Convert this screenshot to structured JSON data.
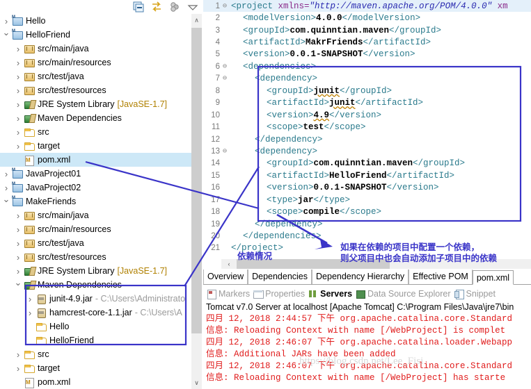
{
  "explorer": {
    "toolbar": [
      {
        "name": "collapse-all-icon",
        "label": "Collapse All"
      },
      {
        "name": "link-with-editor-icon",
        "label": "Link with Editor"
      },
      {
        "name": "view-menu-icon",
        "label": "View Menu"
      },
      {
        "name": "chevron-down-icon",
        "label": "Minimize"
      }
    ],
    "scroll_up": "∧",
    "scroll_down": "∨",
    "tree": [
      {
        "indent": 0,
        "arrow": "closed",
        "icon": "ic-proj",
        "label": "Hello",
        "suffix": "",
        "selected": false
      },
      {
        "indent": 0,
        "arrow": "open",
        "icon": "ic-proj",
        "label": "HelloFriend",
        "suffix": "",
        "selected": false
      },
      {
        "indent": 1,
        "arrow": "closed",
        "icon": "ic-pkg",
        "label": "src/main/java",
        "suffix": "",
        "selected": false
      },
      {
        "indent": 1,
        "arrow": "closed",
        "icon": "ic-pkg",
        "label": "src/main/resources",
        "suffix": "",
        "selected": false
      },
      {
        "indent": 1,
        "arrow": "closed",
        "icon": "ic-pkg",
        "label": "src/test/java",
        "suffix": "",
        "selected": false
      },
      {
        "indent": 1,
        "arrow": "closed",
        "icon": "ic-pkg",
        "label": "src/test/resources",
        "suffix": "",
        "selected": false
      },
      {
        "indent": 1,
        "arrow": "closed",
        "icon": "ic-lib",
        "label": "JRE System Library",
        "suffix": "[JavaSE-1.7]",
        "selected": false
      },
      {
        "indent": 1,
        "arrow": "closed",
        "icon": "ic-lib",
        "label": "Maven Dependencies",
        "suffix": "",
        "selected": false
      },
      {
        "indent": 1,
        "arrow": "closed",
        "icon": "ic-fold",
        "label": "src",
        "suffix": "",
        "selected": false
      },
      {
        "indent": 1,
        "arrow": "closed",
        "icon": "ic-fold",
        "label": "target",
        "suffix": "",
        "selected": false
      },
      {
        "indent": 1,
        "arrow": "none",
        "icon": "ic-xml",
        "label": "pom.xml",
        "suffix": "",
        "selected": true
      },
      {
        "indent": 0,
        "arrow": "closed",
        "icon": "ic-proj",
        "label": "JavaProject01",
        "suffix": "",
        "selected": false
      },
      {
        "indent": 0,
        "arrow": "closed",
        "icon": "ic-proj",
        "label": "JavaProject02",
        "suffix": "",
        "selected": false
      },
      {
        "indent": 0,
        "arrow": "open",
        "icon": "ic-proj",
        "label": "MakeFriends",
        "suffix": "",
        "selected": false
      },
      {
        "indent": 1,
        "arrow": "closed",
        "icon": "ic-pkg",
        "label": "src/main/java",
        "suffix": "",
        "selected": false
      },
      {
        "indent": 1,
        "arrow": "closed",
        "icon": "ic-pkg",
        "label": "src/main/resources",
        "suffix": "",
        "selected": false
      },
      {
        "indent": 1,
        "arrow": "closed",
        "icon": "ic-pkg",
        "label": "src/test/java",
        "suffix": "",
        "selected": false
      },
      {
        "indent": 1,
        "arrow": "closed",
        "icon": "ic-pkg",
        "label": "src/test/resources",
        "suffix": "",
        "selected": false
      },
      {
        "indent": 1,
        "arrow": "closed",
        "icon": "ic-lib",
        "label": "JRE System Library",
        "suffix": "[JavaSE-1.7]",
        "selected": false
      },
      {
        "indent": 1,
        "arrow": "open",
        "icon": "ic-lib",
        "label": "Maven Dependencies",
        "suffix": "",
        "selected": false
      },
      {
        "indent": 2,
        "arrow": "closed",
        "icon": "ic-jar",
        "label": "junit-4.9.jar",
        "suffix": "- C:\\Users\\Administrato",
        "selected": false
      },
      {
        "indent": 2,
        "arrow": "closed",
        "icon": "ic-jar",
        "label": "hamcrest-core-1.1.jar",
        "suffix": "- C:\\Users\\A",
        "selected": false
      },
      {
        "indent": 2,
        "arrow": "none",
        "icon": "ic-fold",
        "label": "Hello",
        "suffix": "",
        "selected": false
      },
      {
        "indent": 2,
        "arrow": "none",
        "icon": "ic-fold",
        "label": "HelloFriend",
        "suffix": "",
        "selected": false
      },
      {
        "indent": 1,
        "arrow": "closed",
        "icon": "ic-fold",
        "label": "src",
        "suffix": "",
        "selected": false
      },
      {
        "indent": 1,
        "arrow": "closed",
        "icon": "ic-fold",
        "label": "target",
        "suffix": "",
        "selected": false
      },
      {
        "indent": 1,
        "arrow": "none",
        "icon": "ic-xml",
        "label": "pom.xml",
        "suffix": "",
        "selected": false
      }
    ]
  },
  "editor": {
    "lines": [
      {
        "n": "1",
        "fold": "⊖",
        "indent": 0,
        "first": true,
        "parts": [
          {
            "t": "tag",
            "v": "<project "
          },
          {
            "t": "attr",
            "v": "xmlns="
          },
          {
            "t": "aval",
            "v": "\"http://maven.apache.org/POM/4.0.0\""
          },
          {
            "t": "attr",
            "v": " xm"
          }
        ]
      },
      {
        "n": "2",
        "fold": "",
        "indent": 1,
        "parts": [
          {
            "t": "tag",
            "v": "<modelVersion>"
          },
          {
            "t": "tagv",
            "v": "4.0.0"
          },
          {
            "t": "tag",
            "v": "</modelVersion>"
          }
        ]
      },
      {
        "n": "3",
        "fold": "",
        "indent": 1,
        "parts": [
          {
            "t": "tag",
            "v": "<groupId>"
          },
          {
            "t": "tagv",
            "v": "com.quinntian.maven"
          },
          {
            "t": "tag",
            "v": "</groupId>"
          }
        ]
      },
      {
        "n": "4",
        "fold": "",
        "indent": 1,
        "parts": [
          {
            "t": "tag",
            "v": "<artifactId>"
          },
          {
            "t": "tagv",
            "v": "MakrFriends"
          },
          {
            "t": "tag",
            "v": "</artifactId>"
          }
        ]
      },
      {
        "n": "5",
        "fold": "",
        "indent": 1,
        "parts": [
          {
            "t": "tag",
            "v": "<version>"
          },
          {
            "t": "tagv",
            "v": "0.0.1-SNAPSHOT"
          },
          {
            "t": "tag",
            "v": "</version>"
          }
        ]
      },
      {
        "n": "6",
        "fold": "⊖",
        "indent": 1,
        "parts": [
          {
            "t": "tag",
            "v": "<dependencies>"
          }
        ]
      },
      {
        "n": "7",
        "fold": "⊖",
        "indent": 2,
        "parts": [
          {
            "t": "tag",
            "v": "<dependency>"
          }
        ]
      },
      {
        "n": "8",
        "fold": "",
        "indent": 3,
        "parts": [
          {
            "t": "tag",
            "v": "<groupId>"
          },
          {
            "t": "tagv sq",
            "v": "junit"
          },
          {
            "t": "tag",
            "v": "</groupId>"
          }
        ]
      },
      {
        "n": "9",
        "fold": "",
        "indent": 3,
        "parts": [
          {
            "t": "tag",
            "v": "<artifactId>"
          },
          {
            "t": "tagv sq",
            "v": "junit"
          },
          {
            "t": "tag",
            "v": "</artifactId>"
          }
        ]
      },
      {
        "n": "10",
        "fold": "",
        "indent": 3,
        "parts": [
          {
            "t": "tag",
            "v": "<version>"
          },
          {
            "t": "tagv sq",
            "v": "4.9"
          },
          {
            "t": "tag",
            "v": "</version>"
          }
        ]
      },
      {
        "n": "11",
        "fold": "",
        "indent": 3,
        "parts": [
          {
            "t": "tag",
            "v": "<scope>"
          },
          {
            "t": "tagv",
            "v": "test"
          },
          {
            "t": "tag",
            "v": "</scope>"
          }
        ]
      },
      {
        "n": "12",
        "fold": "",
        "indent": 2,
        "parts": [
          {
            "t": "tag",
            "v": "</dependency>"
          }
        ]
      },
      {
        "n": "13",
        "fold": "⊖",
        "indent": 2,
        "parts": [
          {
            "t": "tag",
            "v": "<dependency>"
          }
        ]
      },
      {
        "n": "14",
        "fold": "",
        "indent": 3,
        "parts": [
          {
            "t": "tag",
            "v": "<groupId>"
          },
          {
            "t": "tagv",
            "v": "com.quinntian.maven"
          },
          {
            "t": "tag",
            "v": "</groupId>"
          }
        ]
      },
      {
        "n": "15",
        "fold": "",
        "indent": 3,
        "parts": [
          {
            "t": "tag",
            "v": "<artifactId>"
          },
          {
            "t": "tagv",
            "v": "HelloFriend"
          },
          {
            "t": "tag",
            "v": "</artifactId>"
          }
        ]
      },
      {
        "n": "16",
        "fold": "",
        "indent": 3,
        "parts": [
          {
            "t": "tag",
            "v": "<version>"
          },
          {
            "t": "tagv",
            "v": "0.0.1-SNAPSHOT"
          },
          {
            "t": "tag",
            "v": "</version>"
          }
        ]
      },
      {
        "n": "17",
        "fold": "",
        "indent": 3,
        "parts": [
          {
            "t": "tag",
            "v": "<type>"
          },
          {
            "t": "tagv",
            "v": "jar"
          },
          {
            "t": "tag",
            "v": "</type>"
          }
        ]
      },
      {
        "n": "18",
        "fold": "",
        "indent": 3,
        "parts": [
          {
            "t": "tag",
            "v": "<scope>"
          },
          {
            "t": "tagv",
            "v": "compile"
          },
          {
            "t": "tag",
            "v": "</scope>"
          }
        ]
      },
      {
        "n": "19",
        "fold": "",
        "indent": 2,
        "parts": [
          {
            "t": "tag",
            "v": "</dependency>"
          }
        ]
      },
      {
        "n": "20",
        "fold": "",
        "indent": 1,
        "parts": [
          {
            "t": "tag",
            "v": "</dependencies>"
          }
        ]
      },
      {
        "n": "21",
        "fold": "",
        "indent": 0,
        "parts": [
          {
            "t": "tag",
            "v": "</project>"
          }
        ]
      }
    ],
    "hscroll_left": "‹",
    "tabs": [
      {
        "label": "Overview",
        "active": false
      },
      {
        "label": "Dependencies",
        "active": false
      },
      {
        "label": "Dependency Hierarchy",
        "active": false
      },
      {
        "label": "Effective POM",
        "active": false
      },
      {
        "label": "pom.xml",
        "active": true
      }
    ]
  },
  "bottom_views": [
    {
      "label": "Markers",
      "icon": "vi-mark",
      "active": false
    },
    {
      "label": "Properties",
      "icon": "vi-prop",
      "active": false
    },
    {
      "label": "Servers",
      "icon": "vi-srv",
      "active": true
    },
    {
      "label": "Data Source Explorer",
      "icon": "vi-ds",
      "active": false
    },
    {
      "label": "Snippet",
      "icon": "vi-sn",
      "active": false
    }
  ],
  "console": {
    "title": "Tomcat v7.0 Server at localhost [Apache Tomcat] C:\\Program Files\\Java\\jre7\\bin",
    "lines": [
      "四月 12, 2018 2:44:57 下午 org.apache.catalina.core.Standard",
      "信息: Reloading Context with name [/WebProject] is complet",
      "四月 12, 2018 2:46:07 下午 org.apache.catalina.loader.Webapp",
      "信息:    Additional JARs have been added",
      "四月 12, 2018 2:46:07 下午 org.apache.catalina.core.Standard",
      "信息: Reloading Context with name [/WebProject] has starte"
    ],
    "watermark": "https://blog.csdn.net/Lee_Fisi"
  },
  "annotations": {
    "accent_color": "#3a34c8",
    "dependency_label": "依赖情况",
    "note_line1": "如果在依赖的项目中配置一个依赖，",
    "note_line2": "则父项目中也会自动添加子项目中的依赖"
  }
}
